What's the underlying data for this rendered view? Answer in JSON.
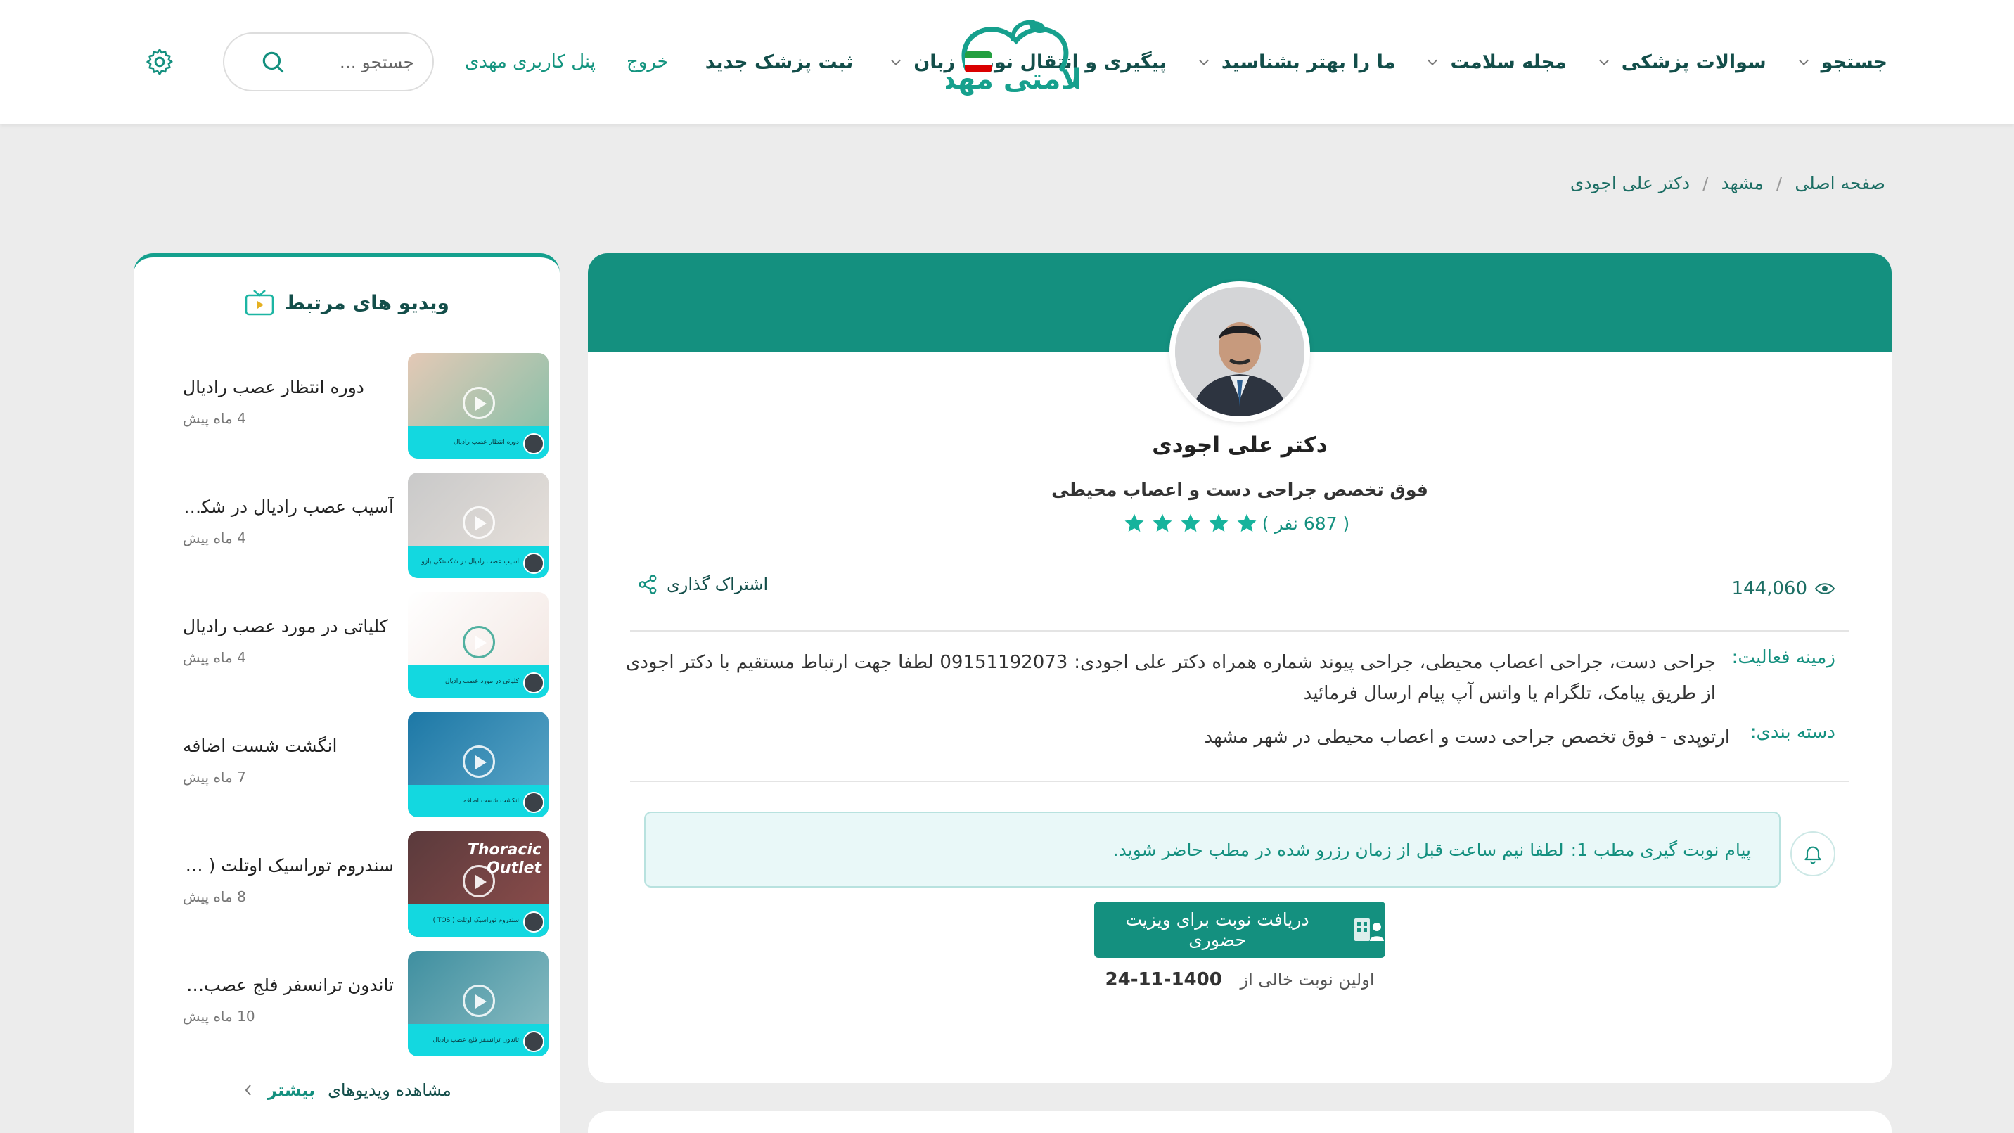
{
  "header": {
    "nav": [
      {
        "label": "جستجو",
        "dropdown": true
      },
      {
        "label": "سوالات پزشکی",
        "dropdown": true
      },
      {
        "label": "مجله سلامت",
        "dropdown": true
      },
      {
        "label": "ما را بهتر بشناسید",
        "dropdown": true
      },
      {
        "label": "پیگیری و انتقال نوبت",
        "dropdown": false
      }
    ],
    "logo_text": "سلامتی مهدی",
    "language_label": "زبان",
    "register_doctor": "ثبت پزشک جدید",
    "logout": "خروج",
    "user_panel": "پنل کاربری مهدی",
    "search_placeholder": "جستجو ...",
    "accent_color": "#14907f"
  },
  "breadcrumb": [
    "صفحه اصلی",
    "مشهد",
    "دکتر علی اجودی"
  ],
  "profile": {
    "name": "دکتر علی اجودی",
    "specialty": "فوق تخصص جراحی دست و اعصاب محیطی",
    "rating_stars": 5,
    "rating_count": "( 687 نفر )",
    "share_label": "اشتراک گذاری",
    "views": "144,060",
    "field_label": "زمینه فعالیت:",
    "field_value": "جراحی دست، جراحی اعصاب محیطی، جراحی پیوند شماره همراه دکتر علی اجودی: 09151192073 لطفا جهت ارتباط مستقیم با دکتر اجودی از طریق پیامک، تلگرام یا واتس آپ پیام ارسال فرمائید",
    "category_label": "دسته بندی:",
    "category_value": "ارتوپدی - فوق تخصص جراحی دست و اعصاب محیطی در شهر مشهد",
    "notice_title": "پیام نوبت گیری مطب 1:",
    "notice_message": "لطفا نیم ساعت قبل از زمان رزرو شده در مطب حاضر شوید.",
    "appointment_button": "دریافت نوبت برای ویزیت حضوری",
    "first_slot_label": "اولین نوبت خالی از",
    "first_slot_date": "1400-11-24"
  },
  "sidebar": {
    "title": "ویدیو های مرتبط",
    "videos": [
      {
        "title": "دوره انتظار عصب رادیال",
        "time": "4 ماه پیش",
        "thumb_label": "دوره انتظار عصب رادیال"
      },
      {
        "title": "آسیب عصب رادیال در شکستگی بازو",
        "time": "4 ماه پیش",
        "thumb_label": "آسیب عصب رادیال در شکستگی بازو"
      },
      {
        "title": "کلیاتی در مورد عصب رادیال",
        "time": "4 ماه پیش",
        "thumb_label": "کلیاتی در مورد عصب رادیال"
      },
      {
        "title": "انگشت شست اضافه",
        "time": "7 ماه پیش",
        "thumb_label": "انگشت شست اضافه"
      },
      {
        "title": "سندروم توراسیک اوتلت ( TOS )",
        "time": "8 ماه پیش",
        "thumb_label": "سندروم توراسیک اوتلت ( TOS )",
        "overlay": "Thoracic Outlet"
      },
      {
        "title": "تاندون ترانسفر فلج عصب رادیال",
        "time": "10 ماه پیش",
        "thumb_label": "تاندون ترانسفر فلج عصب رادیال"
      }
    ],
    "more_prefix": "مشاهده ویدیوهای",
    "more_bold": "بیشتر"
  }
}
